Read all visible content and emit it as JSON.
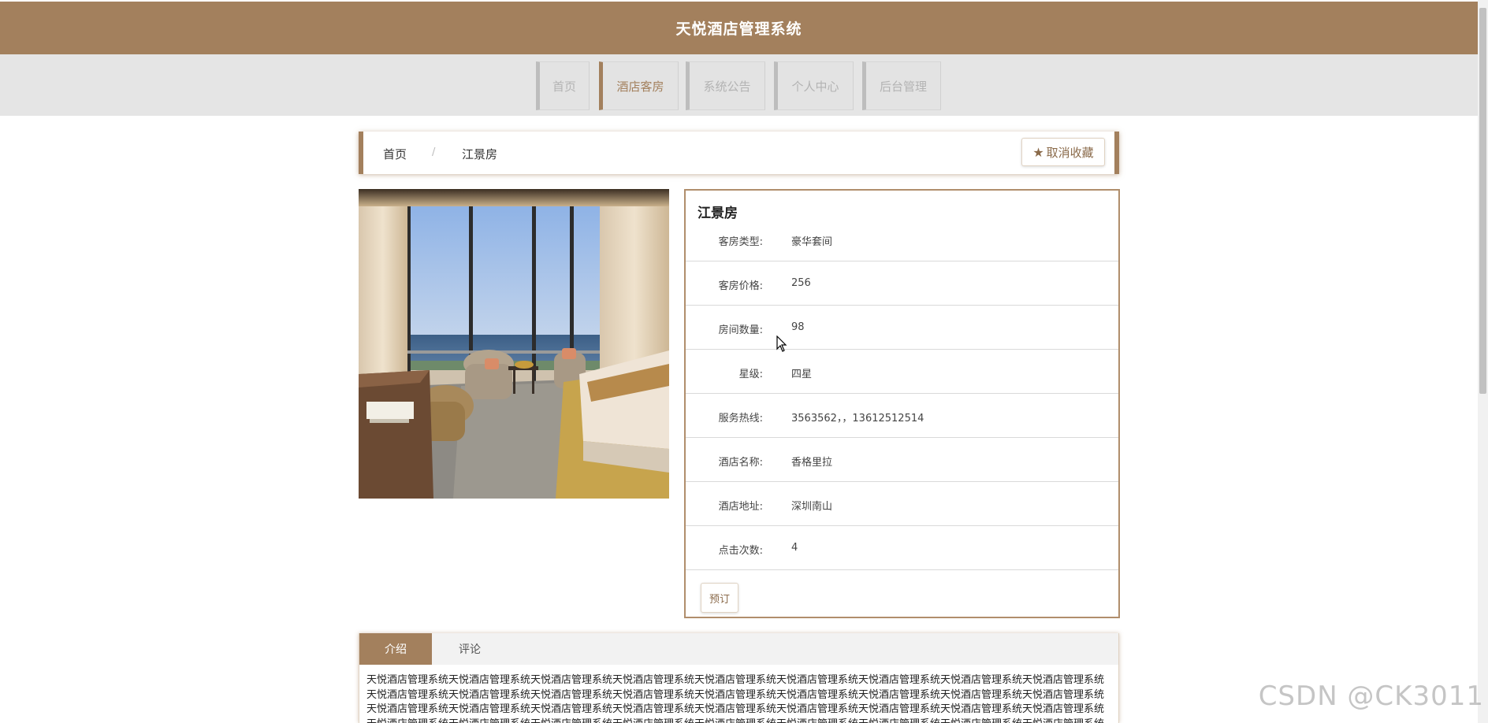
{
  "header": {
    "title": "天悦酒店管理系统"
  },
  "nav": {
    "items": [
      {
        "label": "首页"
      },
      {
        "label": "酒店客房"
      },
      {
        "label": "系统公告"
      },
      {
        "label": "个人中心"
      },
      {
        "label": "后台管理"
      }
    ],
    "active_index": 1
  },
  "breadcrumb": {
    "home": "首页",
    "separator": "/",
    "current": "江景房",
    "fav_label": "取消收藏",
    "fav_icon": "star-icon"
  },
  "room": {
    "image_alt": "hotel-room-photo",
    "title": "江景房",
    "fields": [
      {
        "label": "客房类型:",
        "value": "豪华套间"
      },
      {
        "label": "客房价格:",
        "value": "256"
      },
      {
        "label": "房间数量:",
        "value": "98"
      },
      {
        "label": "星级:",
        "value": "四星"
      },
      {
        "label": "服务热线:",
        "value": "3563562，，13612512514"
      },
      {
        "label": "酒店名称:",
        "value": "香格里拉"
      },
      {
        "label": "酒店地址:",
        "value": "深圳南山"
      },
      {
        "label": "点击次数:",
        "value": "4"
      }
    ],
    "book_label": "预订"
  },
  "tabs": {
    "items": [
      {
        "label": "介绍"
      },
      {
        "label": "评论"
      }
    ],
    "active_index": 0,
    "content": "天悦酒店管理系统天悦酒店管理系统天悦酒店管理系统天悦酒店管理系统天悦酒店管理系统天悦酒店管理系统天悦酒店管理系统天悦酒店管理系统天悦酒店管理系统天悦酒店管理系统天悦酒店管理系统天悦酒店管理系统天悦酒店管理系统天悦酒店管理系统天悦酒店管理系统天悦酒店管理系统天悦酒店管理系统天悦酒店管理系统天悦酒店管理系统天悦酒店管理系统天悦酒店管理系统天悦酒店管理系统天悦酒店管理系统天悦酒店管理系统天悦酒店管理系统天悦酒店管理系统天悦酒店管理系统天悦酒店管理系统天悦酒店管理系统天悦酒店管理系统天悦酒店管理系统天悦酒店管理系统天悦酒店管理系统天悦酒店管理系统天悦酒店管理系统天悦酒店管理系统天悦酒店管理系统天悦酒店管理系统天悦酒店管理系统天悦酒店管理系统天悦酒店管理系统天悦酒店管理系统天悦酒店管理系统天悦酒店管理系统"
  },
  "watermark": "CSDN @CK3011",
  "colors": {
    "brand": "#a3805d",
    "nav_bg": "#e5e5e5",
    "panel_border": "#b08e6c"
  }
}
